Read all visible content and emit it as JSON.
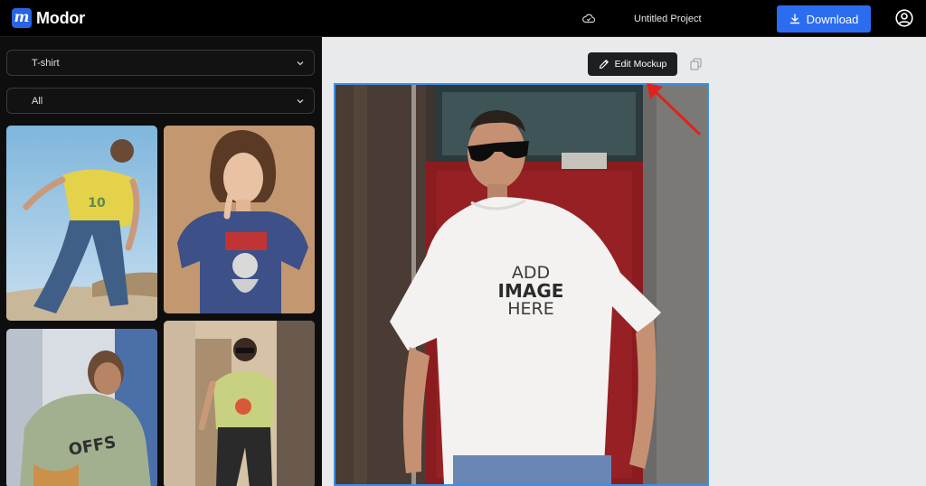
{
  "app": {
    "logo_mark": "m",
    "name": "Modor"
  },
  "header": {
    "project_title": "Untitled Project",
    "download_label": "Download",
    "icons": {
      "cloud": "cloud-icon",
      "download": "download-icon",
      "user": "user-icon"
    }
  },
  "filters": {
    "category": {
      "selected": "T-shirt"
    },
    "subcategory": {
      "selected": "All"
    }
  },
  "canvas": {
    "edit_label": "Edit Mockup",
    "placeholder_lines": [
      "ADD",
      "IMAGE",
      "HERE"
    ]
  },
  "colors": {
    "accent": "#2c6cf1",
    "selection_border": "#3b8fe6",
    "arrow": "#e0221c",
    "canvas_bg": "#e9eaec"
  }
}
